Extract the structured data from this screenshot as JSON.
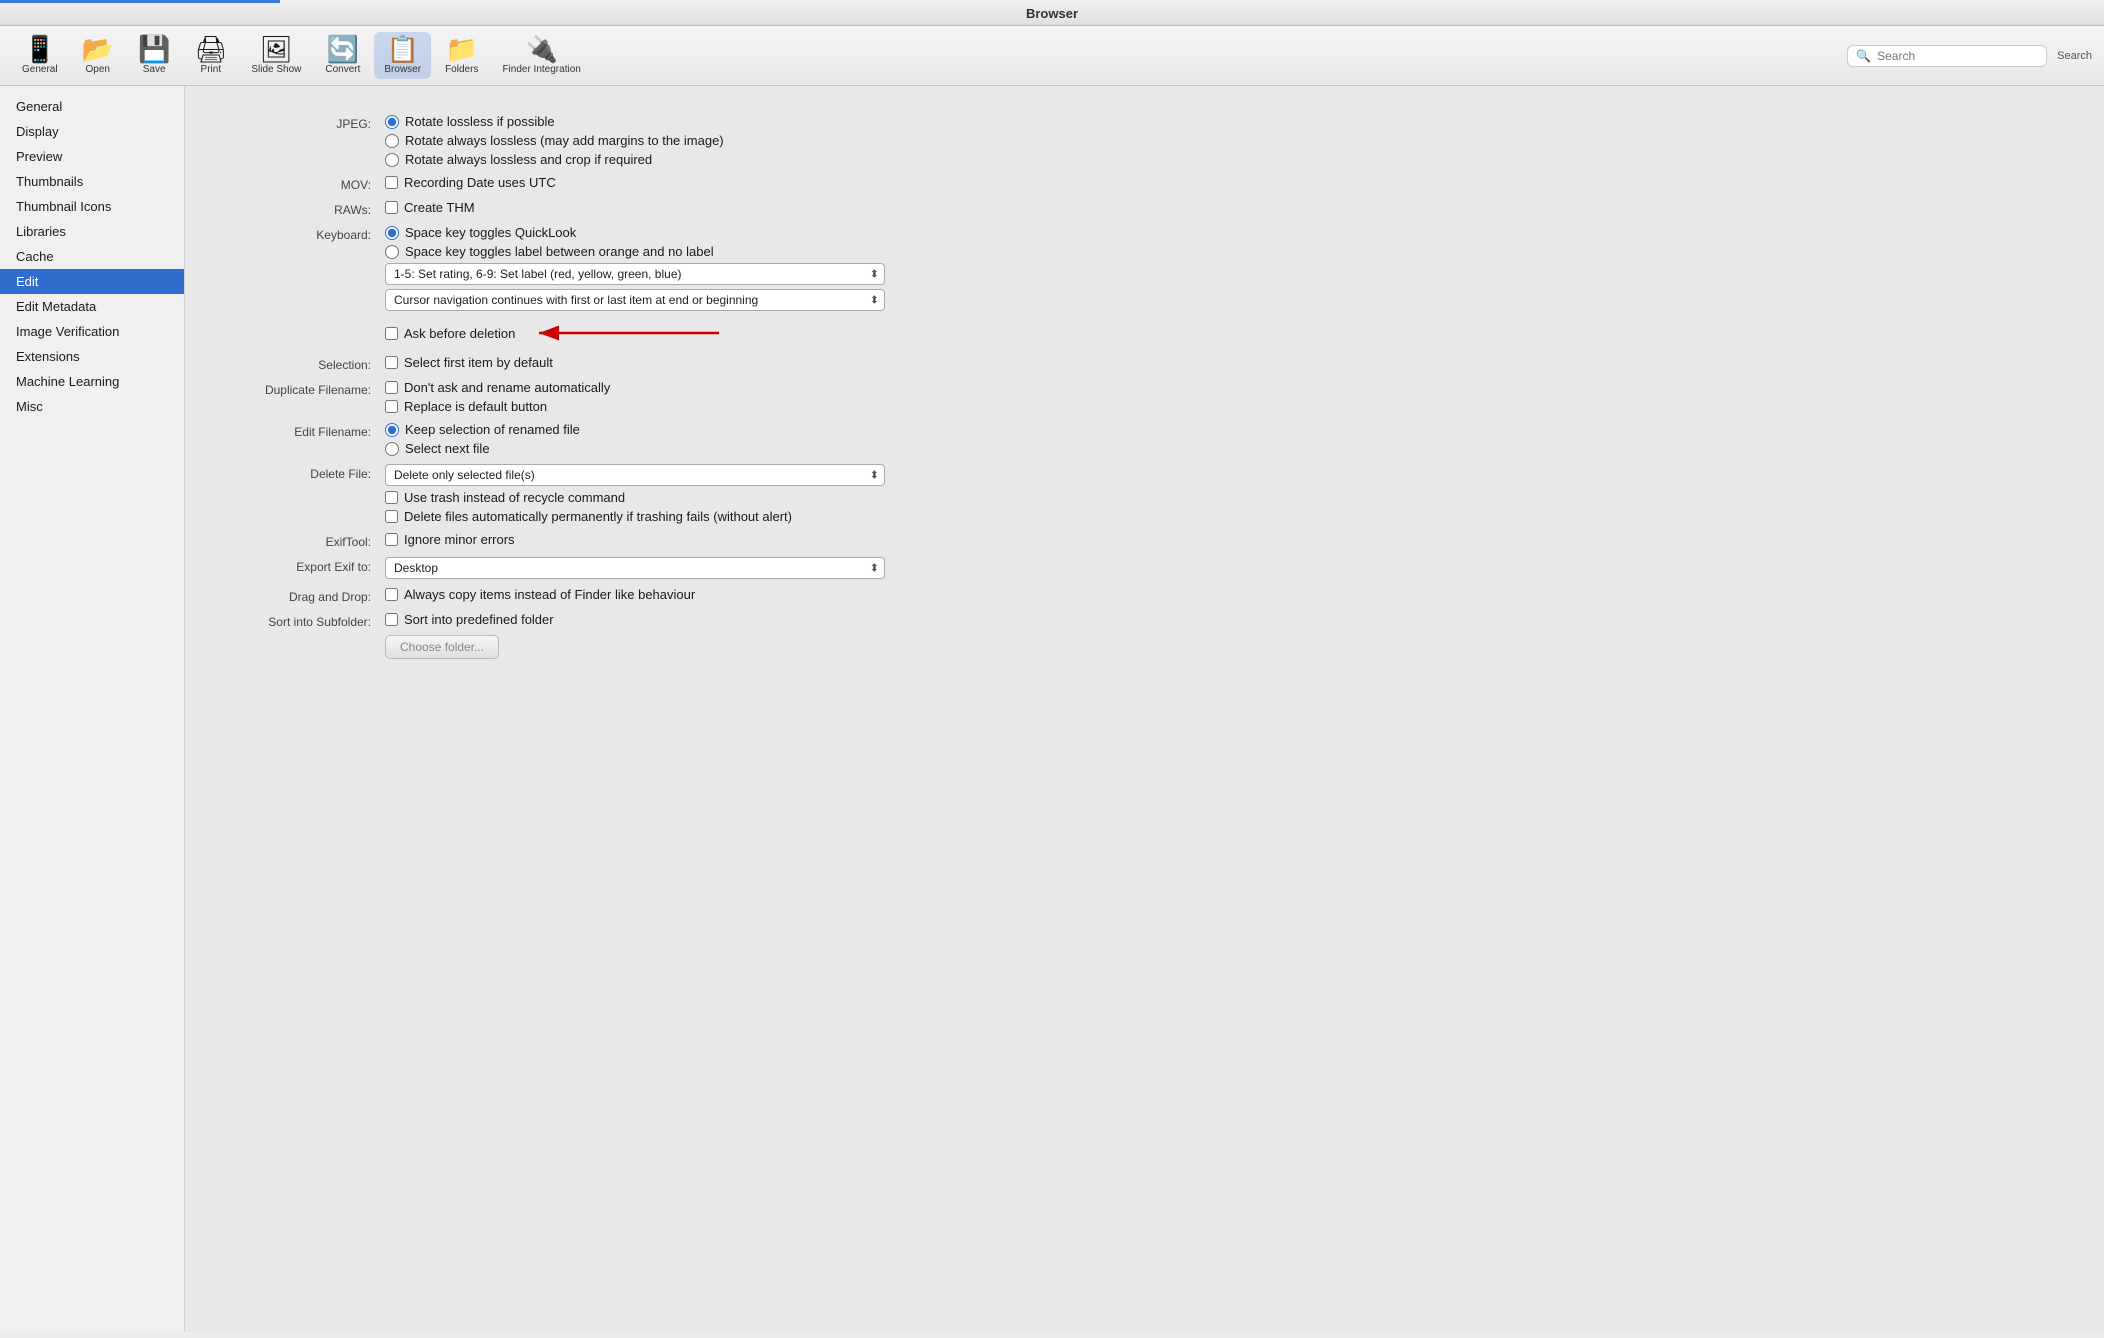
{
  "titleBar": {
    "title": "Browser"
  },
  "toolbar": {
    "items": [
      {
        "id": "general",
        "label": "General",
        "icon": "📱"
      },
      {
        "id": "open",
        "label": "Open",
        "icon": "📂"
      },
      {
        "id": "save",
        "label": "Save",
        "icon": "💾"
      },
      {
        "id": "print",
        "label": "Print",
        "icon": "🖨"
      },
      {
        "id": "slideshow",
        "label": "Slide Show",
        "icon": "🖼"
      },
      {
        "id": "convert",
        "label": "Convert",
        "icon": "🔄"
      },
      {
        "id": "browser",
        "label": "Browser",
        "icon": "📋",
        "active": true
      },
      {
        "id": "folders",
        "label": "Folders",
        "icon": "📁"
      },
      {
        "id": "finder",
        "label": "Finder Integration",
        "icon": "🔌"
      }
    ],
    "search": {
      "placeholder": "Search",
      "label": "Search"
    }
  },
  "sidebar": {
    "items": [
      {
        "id": "general",
        "label": "General"
      },
      {
        "id": "display",
        "label": "Display"
      },
      {
        "id": "preview",
        "label": "Preview"
      },
      {
        "id": "thumbnails",
        "label": "Thumbnails"
      },
      {
        "id": "thumbnail-icons",
        "label": "Thumbnail Icons"
      },
      {
        "id": "libraries",
        "label": "Libraries"
      },
      {
        "id": "cache",
        "label": "Cache"
      },
      {
        "id": "edit",
        "label": "Edit",
        "selected": true
      },
      {
        "id": "edit-metadata",
        "label": "Edit Metadata"
      },
      {
        "id": "image-verification",
        "label": "Image Verification"
      },
      {
        "id": "extensions",
        "label": "Extensions"
      },
      {
        "id": "machine-learning",
        "label": "Machine Learning"
      },
      {
        "id": "misc",
        "label": "Misc"
      }
    ]
  },
  "content": {
    "sections": [
      {
        "label": "JPEG:",
        "controls": [
          {
            "type": "radio",
            "name": "jpeg",
            "checked": true,
            "text": "Rotate lossless if possible"
          },
          {
            "type": "radio",
            "name": "jpeg",
            "checked": false,
            "text": "Rotate always lossless (may add margins to the image)"
          },
          {
            "type": "radio",
            "name": "jpeg",
            "checked": false,
            "text": "Rotate always lossless and crop if required"
          }
        ]
      },
      {
        "label": "MOV:",
        "controls": [
          {
            "type": "checkbox",
            "checked": false,
            "text": "Recording Date uses UTC"
          }
        ]
      },
      {
        "label": "RAWs:",
        "controls": [
          {
            "type": "checkbox",
            "checked": false,
            "text": "Create THM"
          }
        ]
      },
      {
        "label": "Keyboard:",
        "controls": [
          {
            "type": "radio",
            "name": "keyboard",
            "checked": true,
            "text": "Space key toggles QuickLook"
          },
          {
            "type": "radio",
            "name": "keyboard",
            "checked": false,
            "text": "Space key toggles label between orange and no label"
          },
          {
            "type": "dropdown",
            "value": "1-5: Set rating, 6-9: Set label (red, yellow, green, blue)",
            "options": [
              "1-5: Set rating, 6-9: Set label (red, yellow, green, blue)"
            ]
          },
          {
            "type": "dropdown",
            "value": "Cursor navigation continues with first or last item at end or beginning",
            "options": [
              "Cursor navigation continues with first or last item at end or beginning"
            ]
          }
        ]
      },
      {
        "label": "",
        "controls": [
          {
            "type": "checkbox",
            "checked": false,
            "text": "Ask before deletion",
            "annotated": true
          }
        ]
      },
      {
        "label": "Selection:",
        "controls": [
          {
            "type": "checkbox",
            "checked": false,
            "text": "Select first item by default"
          }
        ]
      },
      {
        "label": "Duplicate Filename:",
        "controls": [
          {
            "type": "checkbox",
            "checked": false,
            "text": "Don't ask and rename automatically"
          },
          {
            "type": "checkbox",
            "checked": false,
            "text": "Replace is default button"
          }
        ]
      },
      {
        "label": "Edit Filename:",
        "controls": [
          {
            "type": "radio",
            "name": "editfilename",
            "checked": true,
            "text": "Keep selection of renamed file"
          },
          {
            "type": "radio",
            "name": "editfilename",
            "checked": false,
            "text": "Select next file"
          }
        ]
      },
      {
        "label": "Delete File:",
        "controls": [
          {
            "type": "dropdown",
            "value": "Delete only selected file(s)",
            "options": [
              "Delete only selected file(s)"
            ]
          },
          {
            "type": "checkbox",
            "checked": false,
            "text": "Use trash instead of recycle command"
          },
          {
            "type": "checkbox",
            "checked": false,
            "text": "Delete files automatically permanently if trashing fails (without alert)"
          }
        ]
      },
      {
        "label": "ExifTool:",
        "controls": [
          {
            "type": "checkbox",
            "checked": false,
            "text": "Ignore minor errors"
          }
        ]
      },
      {
        "label": "Export Exif to:",
        "controls": [
          {
            "type": "dropdown",
            "value": "Desktop",
            "options": [
              "Desktop"
            ]
          }
        ]
      },
      {
        "label": "Drag  and Drop:",
        "controls": [
          {
            "type": "checkbox",
            "checked": false,
            "text": "Always copy items instead of Finder like behaviour"
          }
        ]
      },
      {
        "label": "Sort into Subfolder:",
        "controls": [
          {
            "type": "checkbox",
            "checked": false,
            "text": "Sort into predefined folder"
          },
          {
            "type": "button",
            "text": "Choose folder..."
          }
        ]
      }
    ]
  }
}
